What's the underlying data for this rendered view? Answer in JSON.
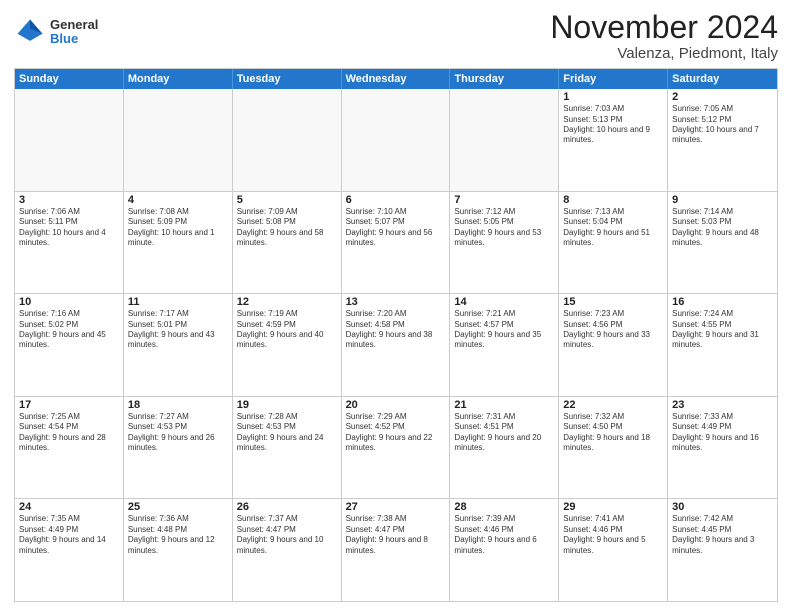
{
  "header": {
    "logo_line1": "General",
    "logo_line2": "Blue",
    "month": "November 2024",
    "location": "Valenza, Piedmont, Italy"
  },
  "weekdays": [
    "Sunday",
    "Monday",
    "Tuesday",
    "Wednesday",
    "Thursday",
    "Friday",
    "Saturday"
  ],
  "rows": [
    {
      "cells": [
        {
          "empty": true
        },
        {
          "empty": true
        },
        {
          "empty": true
        },
        {
          "empty": true
        },
        {
          "empty": true
        },
        {
          "day": "1",
          "info": "Sunrise: 7:03 AM\nSunset: 5:13 PM\nDaylight: 10 hours and 9 minutes."
        },
        {
          "day": "2",
          "info": "Sunrise: 7:05 AM\nSunset: 5:12 PM\nDaylight: 10 hours and 7 minutes."
        }
      ]
    },
    {
      "cells": [
        {
          "day": "3",
          "info": "Sunrise: 7:06 AM\nSunset: 5:11 PM\nDaylight: 10 hours and 4 minutes."
        },
        {
          "day": "4",
          "info": "Sunrise: 7:08 AM\nSunset: 5:09 PM\nDaylight: 10 hours and 1 minute."
        },
        {
          "day": "5",
          "info": "Sunrise: 7:09 AM\nSunset: 5:08 PM\nDaylight: 9 hours and 58 minutes."
        },
        {
          "day": "6",
          "info": "Sunrise: 7:10 AM\nSunset: 5:07 PM\nDaylight: 9 hours and 56 minutes."
        },
        {
          "day": "7",
          "info": "Sunrise: 7:12 AM\nSunset: 5:05 PM\nDaylight: 9 hours and 53 minutes."
        },
        {
          "day": "8",
          "info": "Sunrise: 7:13 AM\nSunset: 5:04 PM\nDaylight: 9 hours and 51 minutes."
        },
        {
          "day": "9",
          "info": "Sunrise: 7:14 AM\nSunset: 5:03 PM\nDaylight: 9 hours and 48 minutes."
        }
      ]
    },
    {
      "cells": [
        {
          "day": "10",
          "info": "Sunrise: 7:16 AM\nSunset: 5:02 PM\nDaylight: 9 hours and 45 minutes."
        },
        {
          "day": "11",
          "info": "Sunrise: 7:17 AM\nSunset: 5:01 PM\nDaylight: 9 hours and 43 minutes."
        },
        {
          "day": "12",
          "info": "Sunrise: 7:19 AM\nSunset: 4:59 PM\nDaylight: 9 hours and 40 minutes."
        },
        {
          "day": "13",
          "info": "Sunrise: 7:20 AM\nSunset: 4:58 PM\nDaylight: 9 hours and 38 minutes."
        },
        {
          "day": "14",
          "info": "Sunrise: 7:21 AM\nSunset: 4:57 PM\nDaylight: 9 hours and 35 minutes."
        },
        {
          "day": "15",
          "info": "Sunrise: 7:23 AM\nSunset: 4:56 PM\nDaylight: 9 hours and 33 minutes."
        },
        {
          "day": "16",
          "info": "Sunrise: 7:24 AM\nSunset: 4:55 PM\nDaylight: 9 hours and 31 minutes."
        }
      ]
    },
    {
      "cells": [
        {
          "day": "17",
          "info": "Sunrise: 7:25 AM\nSunset: 4:54 PM\nDaylight: 9 hours and 28 minutes."
        },
        {
          "day": "18",
          "info": "Sunrise: 7:27 AM\nSunset: 4:53 PM\nDaylight: 9 hours and 26 minutes."
        },
        {
          "day": "19",
          "info": "Sunrise: 7:28 AM\nSunset: 4:53 PM\nDaylight: 9 hours and 24 minutes."
        },
        {
          "day": "20",
          "info": "Sunrise: 7:29 AM\nSunset: 4:52 PM\nDaylight: 9 hours and 22 minutes."
        },
        {
          "day": "21",
          "info": "Sunrise: 7:31 AM\nSunset: 4:51 PM\nDaylight: 9 hours and 20 minutes."
        },
        {
          "day": "22",
          "info": "Sunrise: 7:32 AM\nSunset: 4:50 PM\nDaylight: 9 hours and 18 minutes."
        },
        {
          "day": "23",
          "info": "Sunrise: 7:33 AM\nSunset: 4:49 PM\nDaylight: 9 hours and 16 minutes."
        }
      ]
    },
    {
      "cells": [
        {
          "day": "24",
          "info": "Sunrise: 7:35 AM\nSunset: 4:49 PM\nDaylight: 9 hours and 14 minutes."
        },
        {
          "day": "25",
          "info": "Sunrise: 7:36 AM\nSunset: 4:48 PM\nDaylight: 9 hours and 12 minutes."
        },
        {
          "day": "26",
          "info": "Sunrise: 7:37 AM\nSunset: 4:47 PM\nDaylight: 9 hours and 10 minutes."
        },
        {
          "day": "27",
          "info": "Sunrise: 7:38 AM\nSunset: 4:47 PM\nDaylight: 9 hours and 8 minutes."
        },
        {
          "day": "28",
          "info": "Sunrise: 7:39 AM\nSunset: 4:46 PM\nDaylight: 9 hours and 6 minutes."
        },
        {
          "day": "29",
          "info": "Sunrise: 7:41 AM\nSunset: 4:46 PM\nDaylight: 9 hours and 5 minutes."
        },
        {
          "day": "30",
          "info": "Sunrise: 7:42 AM\nSunset: 4:45 PM\nDaylight: 9 hours and 3 minutes."
        }
      ]
    }
  ]
}
